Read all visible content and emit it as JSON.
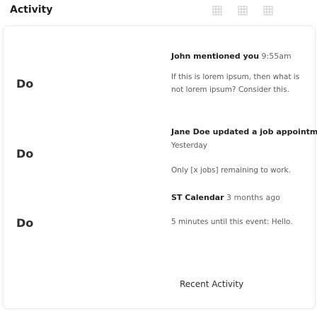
{
  "widget": {
    "title": "Activity",
    "footer_link": "Recent Activity"
  },
  "header_icons": [
    "grid-icon",
    "grid-icon",
    "grid-icon"
  ],
  "items": [
    {
      "avatar": "Do",
      "actor": "John mentioned you",
      "time": "9:55am",
      "body": "If this is lorem ipsum, then what is not lorem ipsum? Consider this."
    },
    {
      "avatar": "Do",
      "actor": "Jane Doe updated a job appointment",
      "time": "Yesterday",
      "body": "Only [x jobs] remaining to work."
    },
    {
      "avatar": "Do",
      "actor": "ST Calendar",
      "time": "3 months ago",
      "body": "5 minutes until this event: Hello."
    }
  ]
}
